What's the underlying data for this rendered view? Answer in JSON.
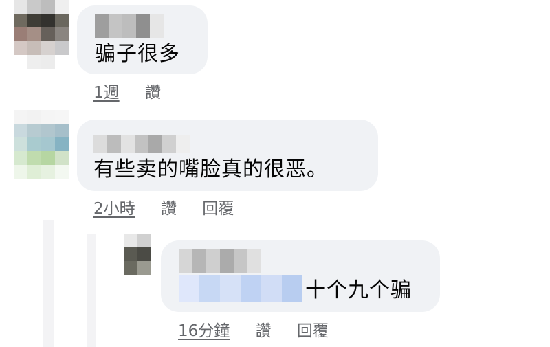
{
  "comments": [
    {
      "text": "骗子很多",
      "timestamp": "1週",
      "like_label": "讚"
    },
    {
      "text": "有些卖的嘴脸真的很恶。",
      "timestamp": "2小時",
      "like_label": "讚",
      "reply_label": "回覆"
    }
  ],
  "reply": {
    "text": "十个九个骗",
    "timestamp": "16分鐘",
    "like_label": "讚",
    "reply_label": "回覆"
  },
  "colors": {
    "bubble": "#f0f2f5",
    "text": "#050505",
    "meta": "#65676b",
    "mention_blur": "#c9d9f4"
  }
}
